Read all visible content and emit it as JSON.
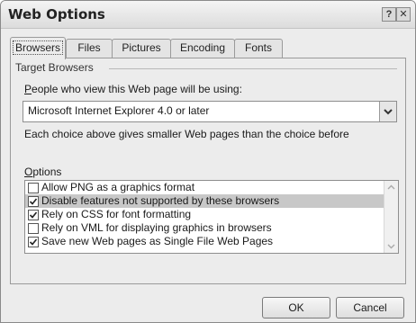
{
  "window": {
    "title": "Web Options"
  },
  "titlebar": {
    "help_glyph": "?",
    "close_glyph": "✕"
  },
  "tabs": [
    {
      "label": "Browsers",
      "active": true
    },
    {
      "label": "Files",
      "active": false
    },
    {
      "label": "Pictures",
      "active": false
    },
    {
      "label": "Encoding",
      "active": false
    },
    {
      "label": "Fonts",
      "active": false
    }
  ],
  "target_browsers": {
    "group_title": "Target Browsers",
    "people_label_hotkey": "P",
    "people_label_rest": "eople who view this Web page will be using:",
    "selected_browser": "Microsoft Internet Explorer 4.0 or later",
    "note": "Each choice above gives smaller Web pages than the choice before"
  },
  "options": {
    "label_hotkey": "O",
    "label_rest": "ptions",
    "items": [
      {
        "label": "Allow PNG as a graphics format",
        "checked": false,
        "selected": false
      },
      {
        "label": "Disable features not supported by these browsers",
        "checked": true,
        "selected": true
      },
      {
        "label": "Rely on CSS for font formatting",
        "checked": true,
        "selected": false
      },
      {
        "label": "Rely on VML for displaying graphics in browsers",
        "checked": false,
        "selected": false
      },
      {
        "label": "Save new Web pages as Single File Web Pages",
        "checked": true,
        "selected": false
      }
    ]
  },
  "buttons": {
    "ok": "OK",
    "cancel": "Cancel"
  },
  "icons": {
    "dropdown": "chevron-down-icon",
    "scroll_up": "chevron-up-icon",
    "scroll_down": "chevron-down-icon",
    "check": "checkmark-icon"
  }
}
